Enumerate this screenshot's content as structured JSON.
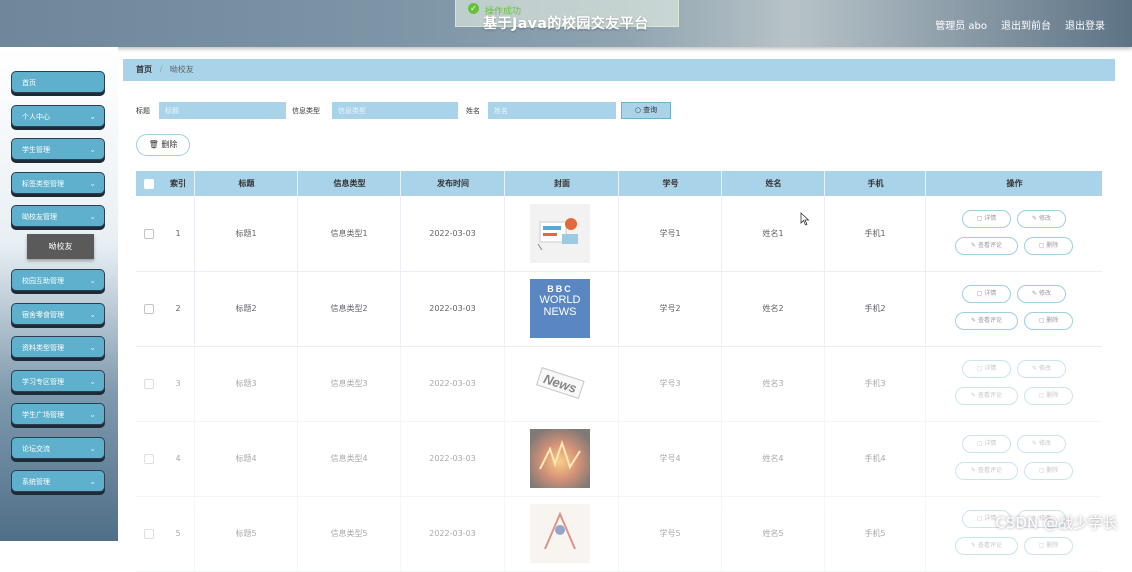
{
  "header": {
    "title": "基于Java的校园交友平台",
    "toast": "操作成功",
    "admin": "管理员 abo",
    "to_front": "退出到前台",
    "logout": "退出登录"
  },
  "sidebar": {
    "items": [
      {
        "label": "首页"
      },
      {
        "label": "个人中心"
      },
      {
        "label": "学生管理"
      },
      {
        "label": "标签类型管理"
      },
      {
        "label": "呦校友管理"
      },
      {
        "label": "校园互助管理"
      },
      {
        "label": "宿舍零食管理"
      },
      {
        "label": "资料类型管理"
      },
      {
        "label": "学习专区管理"
      },
      {
        "label": "学生广场管理"
      },
      {
        "label": "论坛交流"
      },
      {
        "label": "系统管理"
      }
    ],
    "active_sub": "呦校友"
  },
  "breadcrumb": {
    "home": "首页",
    "sep": "/",
    "current": "呦校友"
  },
  "search": {
    "title_label": "标题",
    "title_placeholder": "标题",
    "type_label": "信息类型",
    "type_placeholder": "信息类型",
    "name_label": "姓名",
    "name_placeholder": "姓名",
    "button": "查询"
  },
  "toolbar": {
    "delete": "删除"
  },
  "table": {
    "columns": [
      "索引",
      "标题",
      "信息类型",
      "发布时间",
      "封面",
      "学号",
      "姓名",
      "手机",
      "操作"
    ],
    "rows": [
      {
        "index": "1",
        "title": "标题1",
        "type": "信息类型1",
        "date": "2022-03-03",
        "cover": "illustration",
        "sid": "学号1",
        "name": "姓名1",
        "phone": "手机1"
      },
      {
        "index": "2",
        "title": "标题2",
        "type": "信息类型2",
        "date": "2022-03-03",
        "cover": "bbc-world-news",
        "sid": "学号2",
        "name": "姓名2",
        "phone": "手机2"
      },
      {
        "index": "3",
        "title": "标题3",
        "type": "信息类型3",
        "date": "2022-03-03",
        "cover": "news-stamp",
        "sid": "学号3",
        "name": "姓名3",
        "phone": "手机3"
      },
      {
        "index": "4",
        "title": "标题4",
        "type": "信息类型4",
        "date": "2022-03-03",
        "cover": "fire-text",
        "sid": "学号4",
        "name": "姓名4",
        "phone": "手机4"
      },
      {
        "index": "5",
        "title": "标题5",
        "type": "信息类型5",
        "date": "2022-03-03",
        "cover": "sketch",
        "sid": "学号5",
        "name": "姓名5",
        "phone": "手机5"
      }
    ],
    "actions": {
      "detail": "详情",
      "edit": "修改",
      "comments": "查看评论",
      "delete": "删除"
    }
  },
  "cover_text": {
    "bbc": "BBC",
    "world": "WORLD",
    "news": "NEWS",
    "stamp": "News"
  },
  "watermark": "CSDN @战少学长",
  "colors": {
    "accent": "#a9d3e8",
    "sidebar_button": "#5fb0cc",
    "success": "#67c23a"
  }
}
